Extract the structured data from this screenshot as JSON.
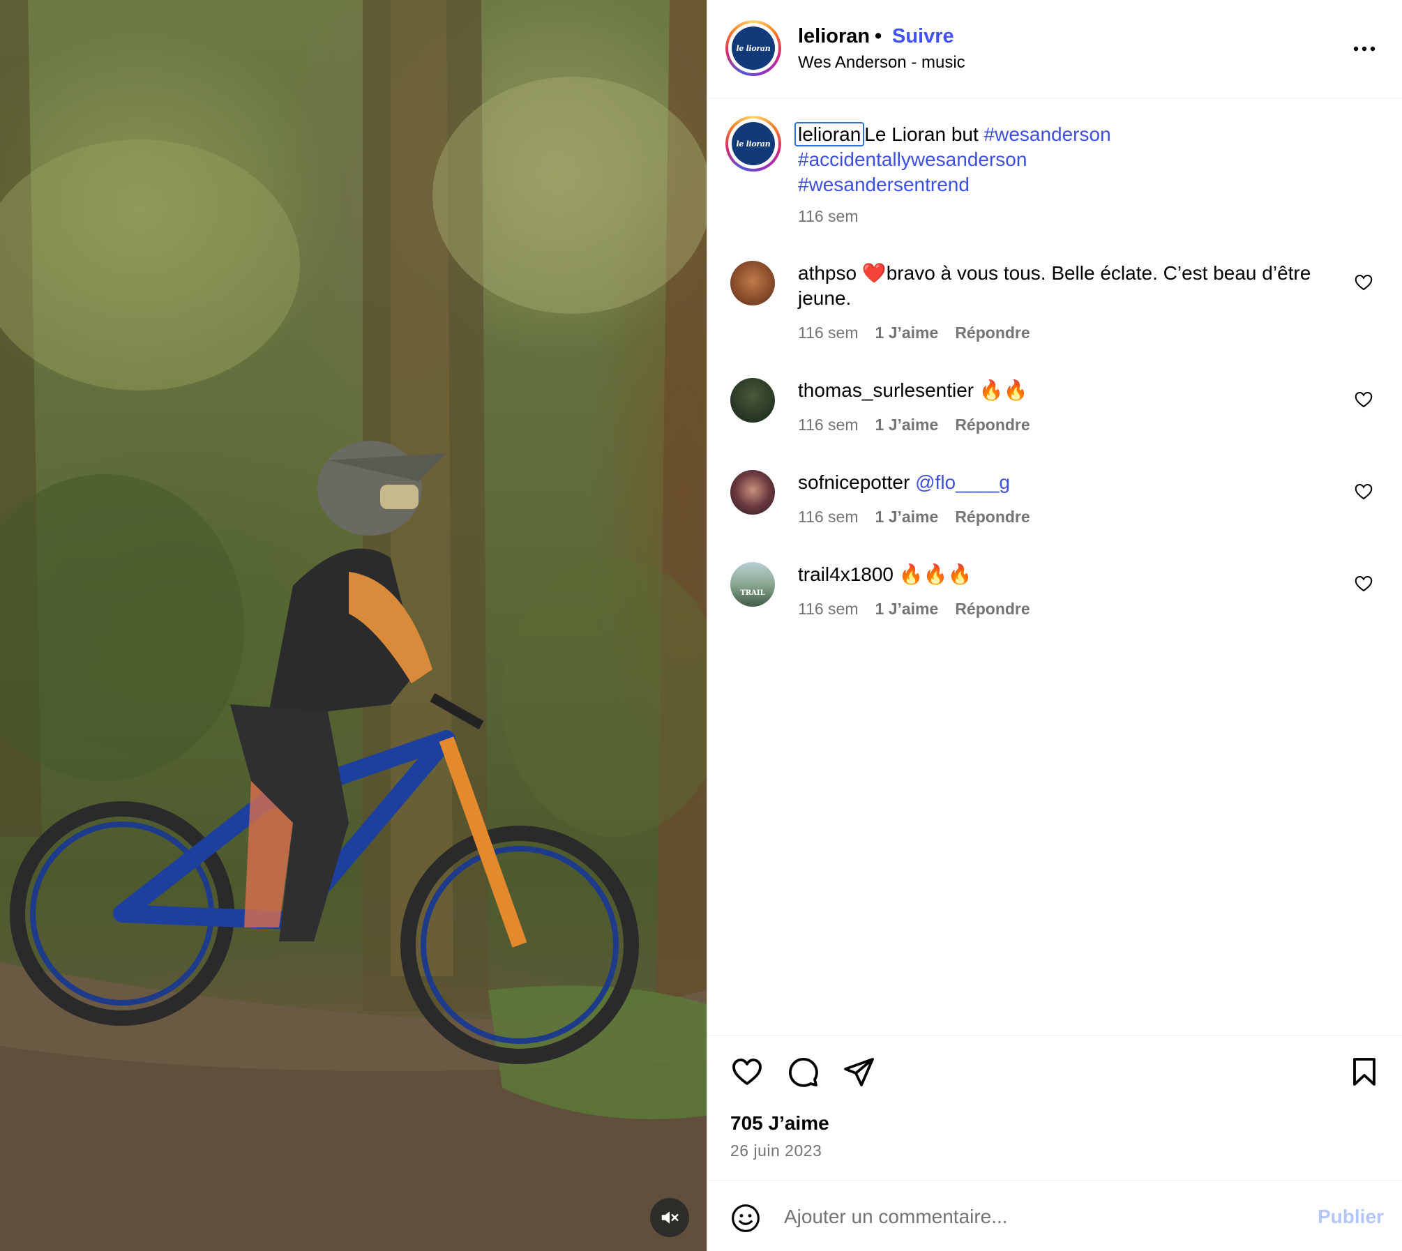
{
  "media": {
    "kind": "video",
    "image_description": "Mountain biker in helmet on blue Specialized bike in a forest",
    "mute_icon": "speaker-muted-icon"
  },
  "header": {
    "username": "lelioran",
    "separator": "•",
    "follow_label": "Suivre",
    "audio": "Wes Anderson - music",
    "avatar_text": "le lioran",
    "more_icon": "more-horizontal-icon"
  },
  "caption": {
    "username": "lelioran",
    "text": "Le Lioran but",
    "hashtags": [
      "#wesanderson",
      "#accidentallywesanderson",
      "#wesandersentrend"
    ],
    "time": "116 sem"
  },
  "comments": [
    {
      "username": "athpso",
      "text_before": "❤️",
      "text": "bravo à vous tous. Belle éclate. C’est beau d’être jeune.",
      "time": "116 sem",
      "likes": "1 J’aime",
      "reply": "Répondre",
      "avatar_color": "#8a4e2c"
    },
    {
      "username": "thomas_surlesentier",
      "text": "🔥🔥",
      "time": "116 sem",
      "likes": "1 J’aime",
      "reply": "Répondre",
      "avatar_color": "#2a3a26"
    },
    {
      "username": "sofnicepotter",
      "mention": "@flo____g",
      "time": "116 sem",
      "likes": "1 J’aime",
      "reply": "Répondre",
      "avatar_color": "#4a2f36"
    },
    {
      "username": "trail4x1800",
      "text": "🔥🔥🔥",
      "time": "116 sem",
      "likes": "1 J’aime",
      "reply": "Répondre",
      "avatar_color": "#6f8a7a",
      "avatar_text": "TRAIL"
    }
  ],
  "actions": {
    "like_icon": "heart-icon",
    "comment_icon": "comment-icon",
    "share_icon": "send-icon",
    "save_icon": "bookmark-icon"
  },
  "likes_count": "705 J’aime",
  "date": "26 juin 2023",
  "comment_box": {
    "placeholder": "Ajouter un commentaire...",
    "emoji_icon": "emoji-icon",
    "publish_label": "Publier"
  },
  "colors": {
    "link_blue": "#4150f7",
    "muted_text": "#737373",
    "publish_disabled": "#b3c6f7"
  }
}
